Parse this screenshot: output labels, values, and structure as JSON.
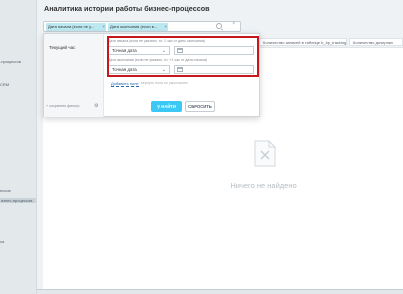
{
  "header": {
    "title": "Аналитика истории работы бизнес-процессов"
  },
  "sidebar": {
    "items": [
      {
        "label": "-процессов"
      },
      {
        "label": "CRM"
      },
      {
        "label": "ессов"
      },
      {
        "label": "изнес-процессов"
      },
      {
        "label": "ca"
      }
    ]
  },
  "filter_bar": {
    "chips": [
      "Дата начала (если не у...",
      "Дата окончания (если в..."
    ]
  },
  "table": {
    "columns": [
      "Количество записей в таблице b_bp_tracking ~",
      "Количество дочерних"
    ]
  },
  "popup": {
    "presets": [
      "Текущий час"
    ],
    "save_filter": "+ сохранить фильтр",
    "fields": [
      {
        "label": "Дата начала (если не указано, то: 1 час от даты окончания)",
        "select": "Точная дата",
        "date": ""
      },
      {
        "label": "Дата окончания (если не указано, то: +1 час от даты начала)",
        "select": "Точная дата",
        "date": ""
      }
    ],
    "add_field": "Добавить поле",
    "restore_fields": "вернуть поля по умолчанию",
    "find_label": "НАЙТИ",
    "reset_label": "СБРОСИТЬ"
  },
  "empty_state": {
    "text": "Ничего не найдено"
  },
  "colors": {
    "accent": "#3bc8f5",
    "chip": "#bce8f1",
    "highlight_frame": "#c4171e"
  }
}
